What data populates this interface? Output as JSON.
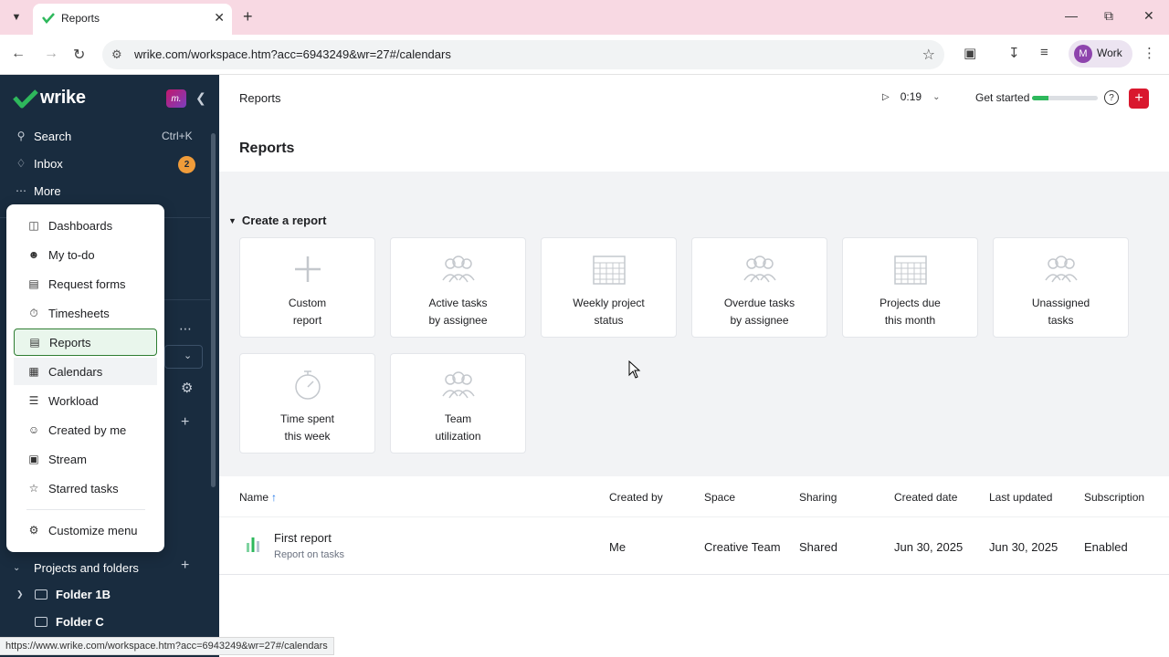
{
  "browser": {
    "tab_title": "Reports",
    "url": "wrike.com/workspace.htm?acc=6943249&wr=27#/calendars",
    "profile_initial": "M",
    "profile_label": "Work",
    "status_url": "https://www.wrike.com/workspace.htm?acc=6943249&wr=27#/calendars"
  },
  "sidebar": {
    "logo": "wrike",
    "workspace_badge": "m.",
    "search_label": "Search",
    "search_shortcut": "Ctrl+K",
    "inbox_label": "Inbox",
    "inbox_count": "2",
    "more_label": "More",
    "projects_label": "Projects and folders",
    "folders": [
      "Folder 1B",
      "Folder C"
    ]
  },
  "menu": {
    "items": [
      {
        "label": "Dashboards",
        "icon": "dashboard-icon"
      },
      {
        "label": "My to-do",
        "icon": "person-list-icon"
      },
      {
        "label": "Request forms",
        "icon": "form-icon"
      },
      {
        "label": "Timesheets",
        "icon": "stopwatch-icon"
      },
      {
        "label": "Reports",
        "icon": "report-icon"
      },
      {
        "label": "Calendars",
        "icon": "calendar-icon"
      },
      {
        "label": "Workload",
        "icon": "workload-icon"
      },
      {
        "label": "Created by me",
        "icon": "person-icon"
      },
      {
        "label": "Stream",
        "icon": "stream-icon"
      },
      {
        "label": "Starred tasks",
        "icon": "star-icon"
      }
    ],
    "customize_label": "Customize menu"
  },
  "topbar": {
    "breadcrumb": "Reports",
    "timer": "0:19",
    "get_started": "Get started",
    "get_started_progress": 0.25
  },
  "page": {
    "title": "Reports",
    "section_title": "Create a report",
    "templates": [
      {
        "label": "Custom\nreport",
        "icon": "plus-icon"
      },
      {
        "label": "Active tasks\nby assignee",
        "icon": "people-icon"
      },
      {
        "label": "Weekly project\nstatus",
        "icon": "calendar-grid-icon"
      },
      {
        "label": "Overdue tasks\nby assignee",
        "icon": "people-icon"
      },
      {
        "label": "Projects due\nthis month",
        "icon": "calendar-grid-icon"
      },
      {
        "label": "Unassigned\ntasks",
        "icon": "people-icon"
      },
      {
        "label": "Time spent\nthis week",
        "icon": "stopwatch-icon"
      },
      {
        "label": "Team\nutilization",
        "icon": "people-icon"
      }
    ]
  },
  "table": {
    "columns": [
      "Name",
      "Created by",
      "Space",
      "Sharing",
      "Created date",
      "Last updated",
      "Subscription"
    ],
    "sort_indicator": "↑",
    "rows": [
      {
        "name": "First report",
        "subtitle": "Report on tasks",
        "created_by": "Me",
        "space": "Creative Team",
        "sharing": "Shared",
        "created_date": "Jun 30, 2025",
        "last_updated": "Jun 30, 2025",
        "subscription": "Enabled"
      }
    ]
  },
  "colors": {
    "sidebar_bg": "#192c3f",
    "brand_green": "#2eb85c",
    "add_red": "#d9182e",
    "badge_orange": "#f09c3a",
    "active_border": "#2e7d32"
  }
}
